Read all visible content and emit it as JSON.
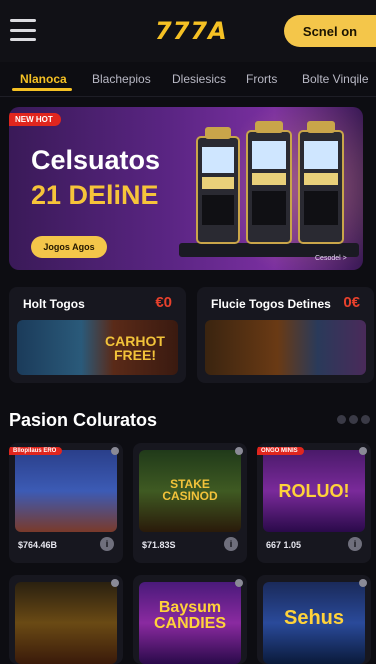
{
  "header": {
    "logo": "777A",
    "signin_label": "Scnel on"
  },
  "tabs": [
    {
      "label": "Nlanoca",
      "active": true
    },
    {
      "label": "Blachepios"
    },
    {
      "label": "Dlesiesics"
    },
    {
      "label": "Frorts"
    },
    {
      "label": "Bolte Vinqile"
    }
  ],
  "banner": {
    "badge": "NEW HOT",
    "title_line1": "Celsuatos",
    "title_line2": "21 DEliNE",
    "cta": "Jogos Agos",
    "caption": "Cesodel >"
  },
  "categories": [
    {
      "title": "Holt Togos",
      "count": "€0",
      "art_text": "CARHOT FREE!"
    },
    {
      "title": "Flucie Togos Detines",
      "count": "0€"
    }
  ],
  "section": {
    "title": "Pasion Coluratos"
  },
  "games": [
    {
      "badge": "Bllopilaus ERO",
      "art_text": "",
      "price": "$764.46B"
    },
    {
      "badge": "",
      "art_text": "STAKE CASINOD",
      "price": "$71.83S"
    },
    {
      "badge": "ONGO MINIS",
      "art_text": "ROLUO!",
      "price": "667 1.05"
    },
    {
      "badge": "",
      "art_text": "",
      "price": ""
    },
    {
      "badge": "",
      "art_text": "Baysum CANDIES",
      "price": ""
    },
    {
      "badge": "",
      "art_text": "Sehus",
      "price": ""
    }
  ],
  "colors": {
    "accent": "#f5c124",
    "background": "#0d0d12",
    "card": "#17171f",
    "badge": "#e0261e"
  }
}
